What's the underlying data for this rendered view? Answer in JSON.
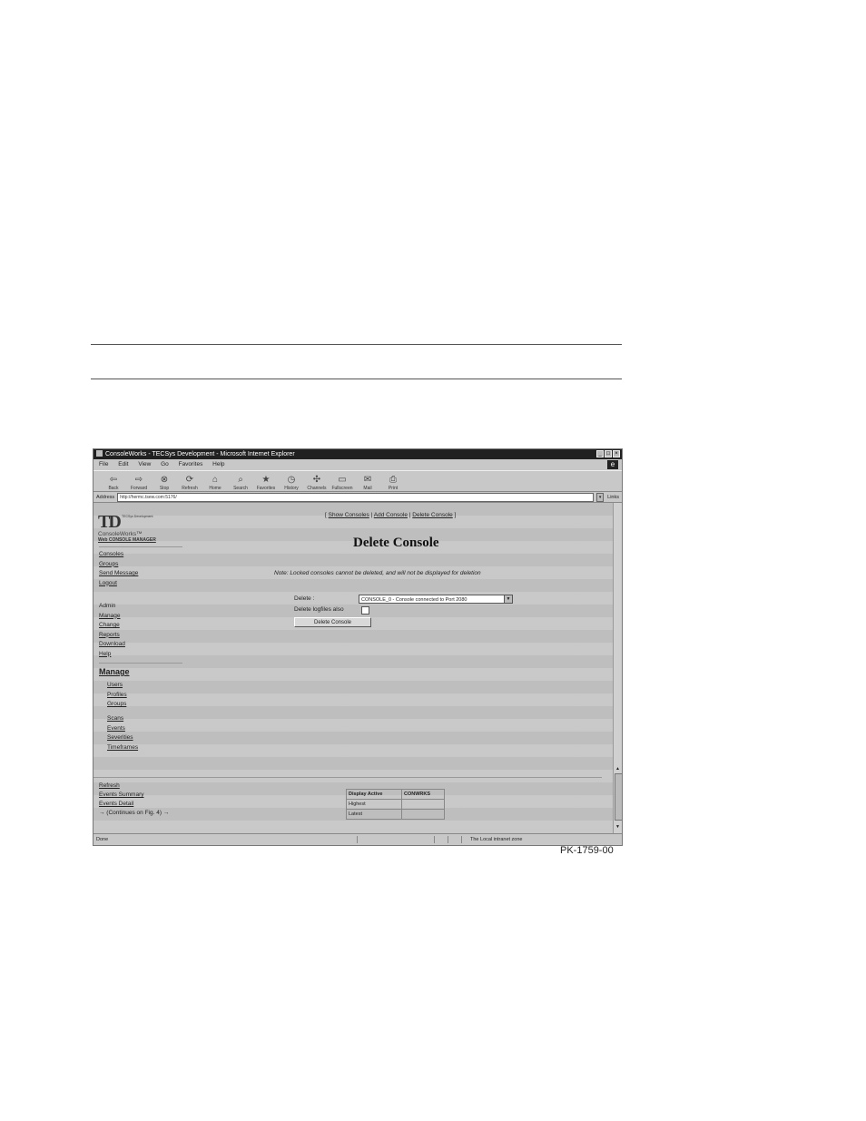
{
  "window": {
    "title": "ConsoleWorks - TECSys Development - Microsoft Internet Explorer",
    "controls": [
      "_",
      "□",
      "×"
    ]
  },
  "menu": [
    "File",
    "Edit",
    "View",
    "Go",
    "Favorites",
    "Help"
  ],
  "toolbar": [
    "Back",
    "Forward",
    "Stop",
    "Refresh",
    "Home",
    "Search",
    "Favorites",
    "History",
    "Channels",
    "Fullscreen",
    "Mail",
    "Print"
  ],
  "address": {
    "label": "Address",
    "value": "http://hermc.tsew.com:5176/",
    "links": "Links"
  },
  "logo": {
    "mark": "TD",
    "small": "TECSys\nDevelopment",
    "product": "ConsoleWorks™",
    "subtitle": "Web CONSOLE MANAGER"
  },
  "nav_primary": [
    "Consoles",
    "Groups",
    "Send Message",
    "Logout"
  ],
  "nav_admin": {
    "title": "Admin",
    "items": [
      "Manage",
      "Change",
      "Reports",
      "Download",
      "Help"
    ]
  },
  "manage": {
    "title": "Manage",
    "items_a": [
      "Users",
      "Profiles",
      "Groups"
    ],
    "items_b": [
      "Scans",
      "Events",
      "Severities",
      "Timeframes"
    ]
  },
  "topnav": [
    "Show Consoles",
    "Add Console",
    "Delete Console"
  ],
  "page_title": "Delete Console",
  "note": "Note: Locked consoles cannot be deleted, and will not be displayed for deletion",
  "form": {
    "delete_label": "Delete :",
    "delete_value": "CONSOLE_0 - Console connected to Port 2080",
    "logfiles_label": "Delete logfiles also",
    "button": "Delete Console"
  },
  "bottom_links": [
    "Refresh",
    "Events Summary",
    "Events Detail"
  ],
  "bottom_note": "→ (Continues on Fig. 4) →",
  "events_table": {
    "headers": [
      "Display Active",
      "CONWRKS"
    ],
    "rows": [
      "Highest",
      "Latest"
    ]
  },
  "status": {
    "left": "Done",
    "right": "The Local intranet zone"
  },
  "figure_id": "PK-1759-00"
}
